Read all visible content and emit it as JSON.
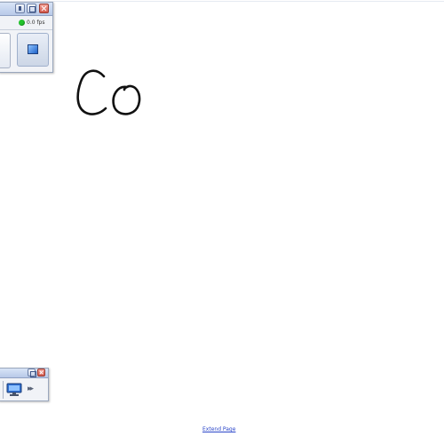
{
  "recorder_panel": {
    "status_text": "0.0 fps",
    "status_color": "#22c42c",
    "buttons": {
      "left_button_icon": "blank-button",
      "screen_button_icon": "screen-capture-icon"
    }
  },
  "whiteboard": {
    "handwriting_text": "Co",
    "ink_color": "#111111"
  },
  "bottom_panel": {
    "monitor_icon": "monitor-icon",
    "forward_icon": "double-chevron-right-icon"
  },
  "extend_page": {
    "label": "Extend Page"
  }
}
